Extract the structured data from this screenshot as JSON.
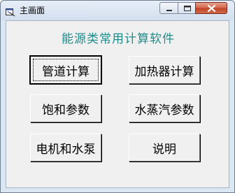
{
  "window": {
    "title": "主画面"
  },
  "titlebar": {
    "buttons": [
      "minimize-icon",
      "maximize-icon",
      "close-icon"
    ],
    "close_color": "#c2452a"
  },
  "main": {
    "heading": "能源类常用计算软件",
    "heading_color": "#1f8c8c",
    "buttons": {
      "pipe_calc": "管道计算",
      "heater_calc": "加热器计算",
      "saturation_params": "饱和参数",
      "steam_params": "水蒸汽参数",
      "motor_pump": "电机和水泵",
      "help": "说明"
    }
  }
}
